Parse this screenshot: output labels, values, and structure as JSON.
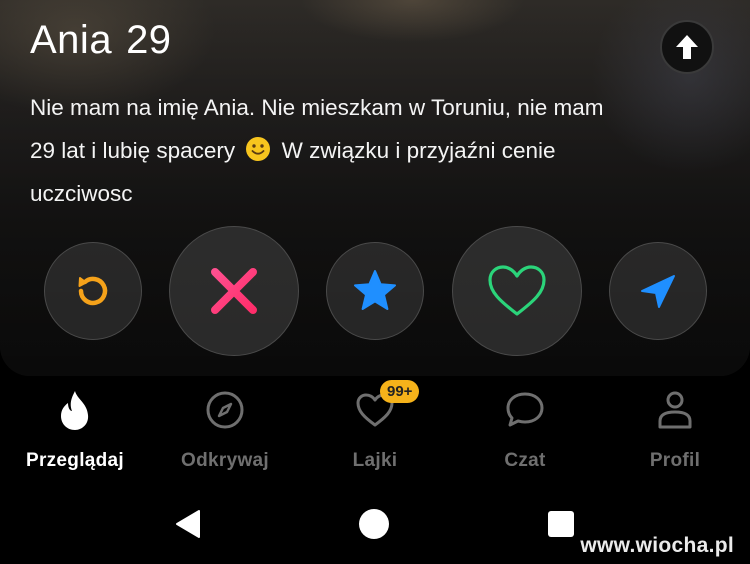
{
  "profile": {
    "name": "Ania",
    "age": "29",
    "bio_line1": "Nie mam na imię Ania. Nie mieszkam w Toruniu, nie mam",
    "bio_line2_before_emoji": "29 lat i lubię spacery",
    "bio_line2_after_emoji": "W związku i przyjaźni cenie",
    "bio_line3": "uczciwosc"
  },
  "actions": [
    {
      "name": "rewind",
      "icon": "rewind-icon",
      "color": "#f5a21a"
    },
    {
      "name": "nope",
      "icon": "x-icon",
      "color": "#fe3c72"
    },
    {
      "name": "super-like",
      "icon": "star-icon",
      "color": "#1f8fff"
    },
    {
      "name": "like",
      "icon": "heart-icon",
      "color": "#2bd47a"
    },
    {
      "name": "boost",
      "icon": "send-icon",
      "color": "#1f8fff"
    }
  ],
  "tabs": [
    {
      "label": "Przeglądaj",
      "icon": "flame-icon",
      "active": true
    },
    {
      "label": "Odkrywaj",
      "icon": "compass-icon",
      "active": false
    },
    {
      "label": "Lajki",
      "icon": "heart-icon",
      "active": false,
      "badge": "99+"
    },
    {
      "label": "Czat",
      "icon": "chat-bubble-icon",
      "active": false
    },
    {
      "label": "Profil",
      "icon": "person-icon",
      "active": false
    }
  ],
  "watermark": "www.wiocha.pl"
}
